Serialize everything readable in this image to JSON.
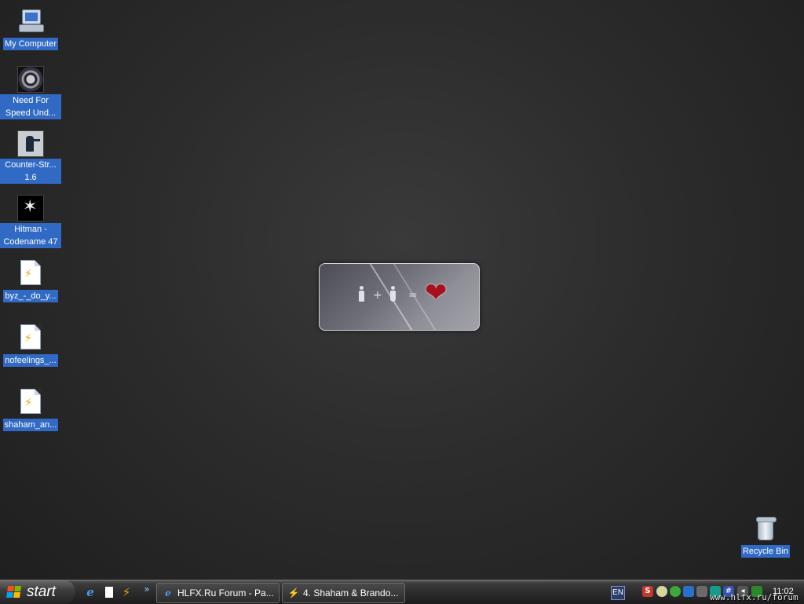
{
  "desktop": {
    "icons": [
      {
        "label": "My Computer",
        "icon": "computer-icon"
      },
      {
        "label": "Need For Speed Und...",
        "icon": "nfs-game-icon"
      },
      {
        "label": "Counter-Str... 1.6",
        "icon": "counter-strike-icon"
      },
      {
        "label": "Hitman - Codename 47",
        "icon": "hitman-icon"
      },
      {
        "label": "byz_-_do_y...",
        "icon": "winamp-file-icon"
      },
      {
        "label": "nofeelings_...",
        "icon": "winamp-file-icon"
      },
      {
        "label": "shaham_an...",
        "icon": "winamp-file-icon"
      }
    ],
    "recycle_bin": {
      "label": "Recycle Bin",
      "icon": "recycle-bin-icon"
    }
  },
  "widget": {
    "plus": "+",
    "equals": "=",
    "heart": "❤"
  },
  "taskbar": {
    "start_label": "start",
    "quick_launch": [
      {
        "icon": "internet-explorer-icon",
        "glyph": "e"
      },
      {
        "icon": "document-icon",
        "glyph": ""
      },
      {
        "icon": "winamp-icon",
        "glyph": "⚡"
      },
      {
        "icon": "more-chevron-icon",
        "glyph": "»"
      }
    ],
    "tasks": [
      {
        "label": "HLFX.Ru Forum - Pa...",
        "icon": "internet-explorer-icon",
        "glyph": "e"
      },
      {
        "label": "4. Shaham & Brando...",
        "icon": "winamp-icon",
        "glyph": "⚡"
      }
    ],
    "language": "EN",
    "tray_icons": [
      "sh-icon",
      "ball-icon",
      "messenger-icon",
      "shield-icon",
      "security-icon",
      "network-icon",
      "hash-icon",
      "volume-icon",
      "network-connection-icon"
    ],
    "clock": "11:02"
  },
  "watermark": "www.hlfx.ru/forum",
  "colors": {
    "selection": "#316ac5",
    "heart": "#a80f1f",
    "taskbar": "#2a2a2a"
  }
}
